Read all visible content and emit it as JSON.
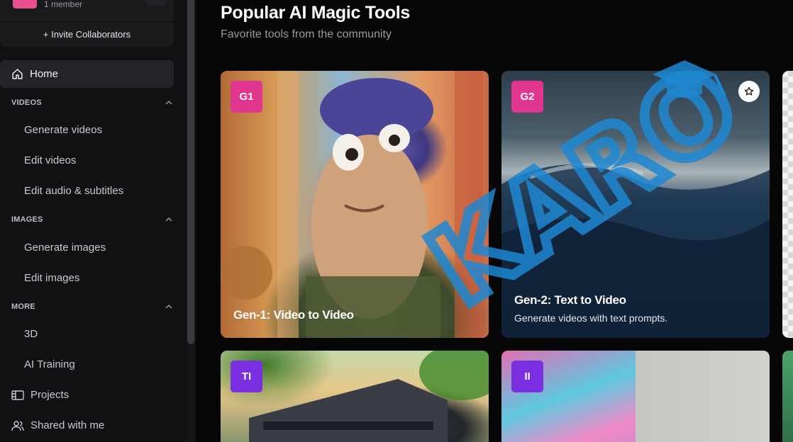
{
  "team": {
    "members": "1 member",
    "invite_label": "+ Invite Collaborators"
  },
  "nav": {
    "home": "Home",
    "sections": [
      {
        "title": "VIDEOS",
        "items": [
          "Generate videos",
          "Edit videos",
          "Edit audio & subtitles"
        ]
      },
      {
        "title": "IMAGES",
        "items": [
          "Generate images",
          "Edit images"
        ]
      },
      {
        "title": "MORE",
        "items": [
          "3D",
          "AI Training"
        ]
      }
    ],
    "projects": "Projects",
    "shared": "Shared with me"
  },
  "main": {
    "title": "Popular AI Magic Tools",
    "subtitle": "Favorite tools from the community",
    "cards": [
      {
        "badge": "G1",
        "badge_color": "#e0368f",
        "title": "Gen-1: Video to Video",
        "description": ""
      },
      {
        "badge": "G2",
        "badge_color": "#e0368f",
        "title": "Gen-2: Text to Video",
        "description": "Generate videos with text prompts."
      },
      {
        "badge": "TI",
        "badge_color": "#7a2fe0",
        "title": "",
        "description": ""
      },
      {
        "badge": "II",
        "badge_color": "#7a2fe0",
        "title": "",
        "description": ""
      }
    ]
  },
  "watermark": {
    "text": "KARO",
    "color": "#1e88d2"
  },
  "colors": {
    "sidebar_bg": "#111113",
    "active_nav": "#242428",
    "accent_pink": "#e0368f",
    "accent_purple": "#7a2fe0"
  }
}
